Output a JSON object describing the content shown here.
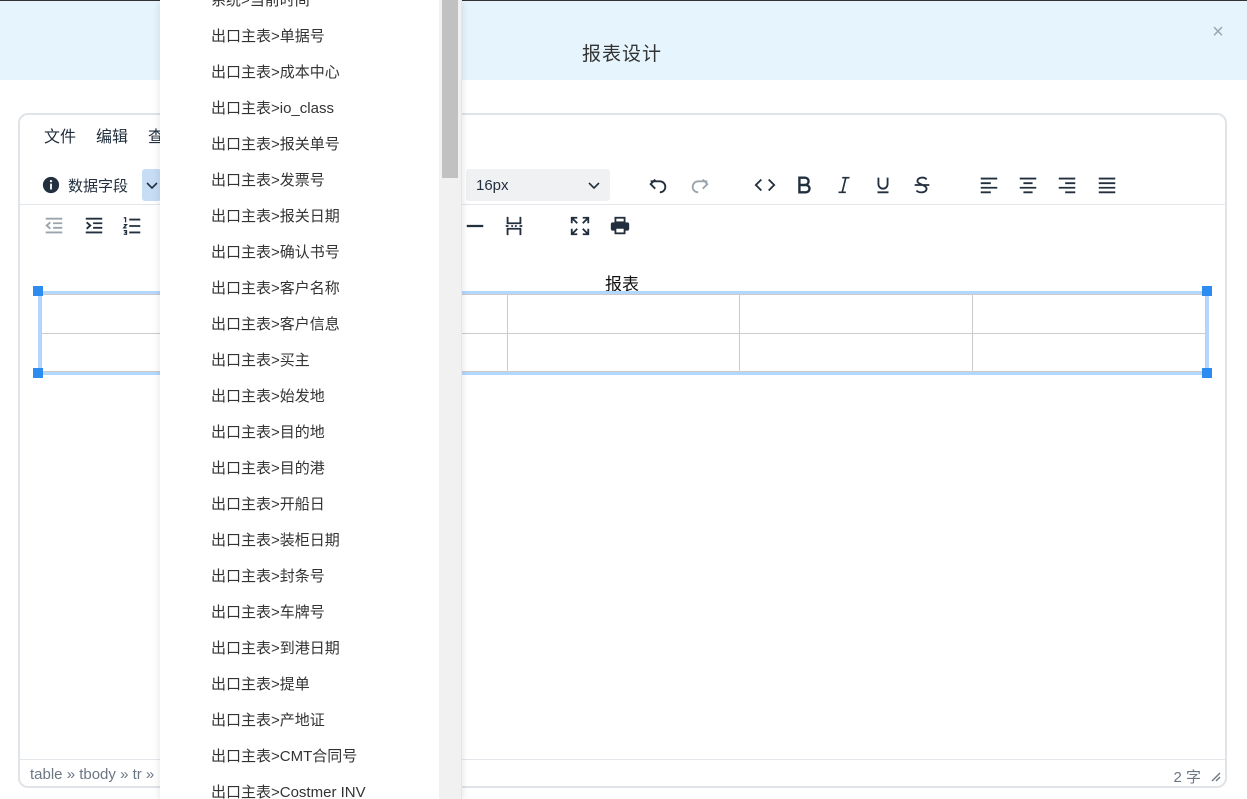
{
  "dialog": {
    "title": "报表设计",
    "close_glyph": "×"
  },
  "menubar": {
    "items": [
      "文件",
      "编辑",
      "查"
    ]
  },
  "toolbar": {
    "fields_label": "数据字段",
    "font_size": "16px",
    "row1_icons": [
      "undo-icon",
      "redo-icon",
      "code-icon",
      "bold-icon",
      "italic-icon",
      "underline-icon",
      "strikethrough-icon",
      "align-left-icon",
      "align-center-icon",
      "align-right-icon",
      "align-justify-icon"
    ],
    "row2_icons": [
      "outdent-icon",
      "indent-icon",
      "numbered-list-icon",
      "horizontal-line-icon",
      "page-break-icon",
      "fullscreen-icon",
      "print-icon"
    ]
  },
  "content": {
    "report_title": "报表"
  },
  "statusbar": {
    "path": "table » tbody » tr »",
    "word_count": "2 字"
  },
  "dropdown": {
    "items": [
      "系统>当前时间",
      "出口主表>单据号",
      "出口主表>成本中心",
      "出口主表>io_class",
      "出口主表>报关单号",
      "出口主表>发票号",
      "出口主表>报关日期",
      "出口主表>确认书号",
      "出口主表>客户名称",
      "出口主表>客户信息",
      "出口主表>买主",
      "出口主表>始发地",
      "出口主表>目的地",
      "出口主表>目的港",
      "出口主表>开船日",
      "出口主表>装柜日期",
      "出口主表>封条号",
      "出口主表>车牌号",
      "出口主表>到港日期",
      "出口主表>提单",
      "出口主表>产地证",
      "出口主表>CMT合同号",
      "出口主表>Costmer INV"
    ]
  },
  "colors": {
    "header_bg": "#e6f4fd",
    "selection_border": "#b4d7ff",
    "handle": "#2d8cf0"
  }
}
